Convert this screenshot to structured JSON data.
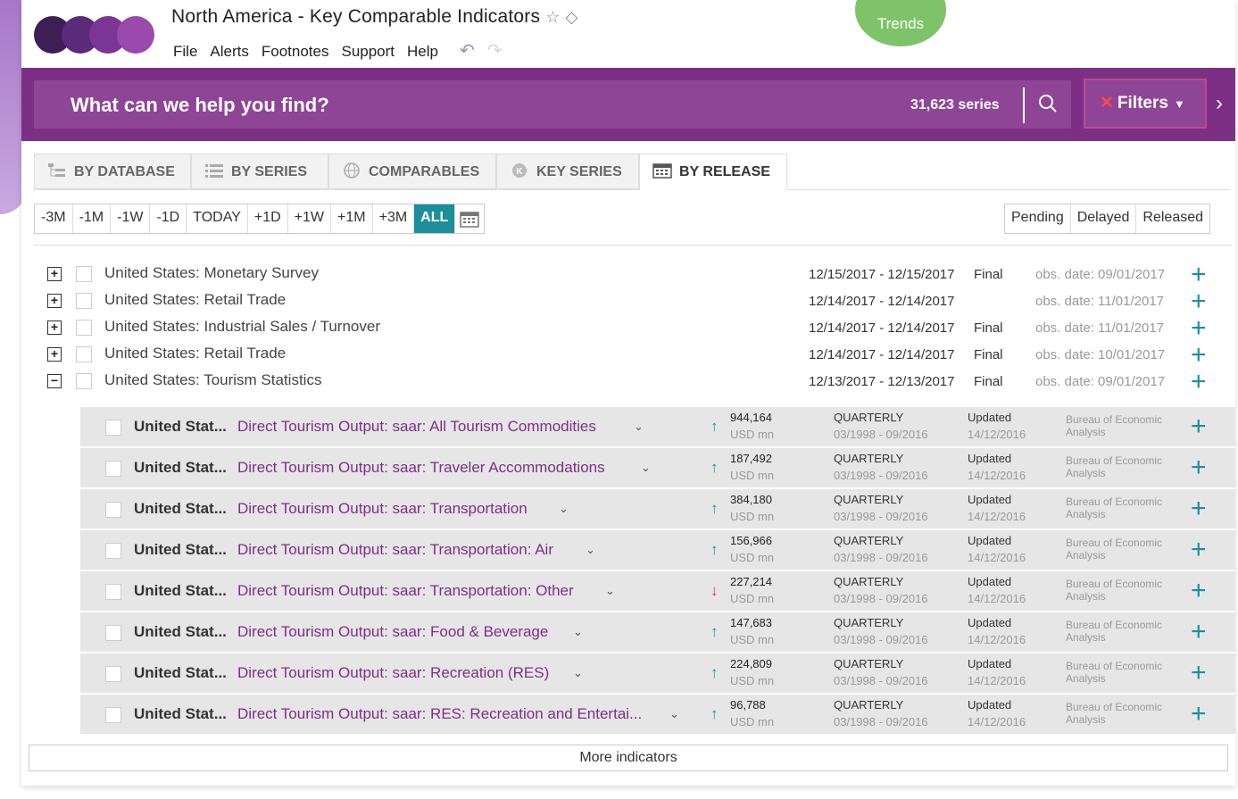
{
  "app": {
    "title": "North America - Key Comparable Indicators",
    "menu": [
      "File",
      "Alerts",
      "Footnotes",
      "Support",
      "Help"
    ],
    "trends_label": "Trends",
    "brand_color": "#7d2f86",
    "accent_color": "#1d8f9a"
  },
  "search": {
    "placeholder": "What can we help you find?",
    "series_count": "31,623 series",
    "filters_label": "Filters"
  },
  "tabs": [
    {
      "label": "BY DATABASE",
      "icon": "database-tree-icon"
    },
    {
      "label": "BY SERIES",
      "icon": "list-icon"
    },
    {
      "label": "COMPARABLES",
      "icon": "globe-icon"
    },
    {
      "label": "KEY SERIES",
      "icon": "key-series-icon"
    },
    {
      "label": "BY RELEASE",
      "icon": "calendar-icon",
      "active": true
    }
  ],
  "date_ranges": [
    "-3M",
    "-1M",
    "-1W",
    "-1D",
    "TODAY",
    "+1D",
    "+1W",
    "+1M",
    "+3M",
    "ALL"
  ],
  "active_range": "ALL",
  "status_buttons": [
    "Pending",
    "Delayed",
    "Released"
  ],
  "releases": [
    {
      "name": "United States: Monetary Survey",
      "dates": "12/15/2017 - 12/15/2017",
      "status": "Final",
      "obs": "obs. date: 09/01/2017",
      "expanded": false
    },
    {
      "name": "United States: Retail Trade",
      "dates": "12/14/2017 - 12/14/2017",
      "status": "",
      "obs": "obs. date: 11/01/2017",
      "expanded": false
    },
    {
      "name": "United States: Industrial Sales / Turnover",
      "dates": "12/14/2017 - 12/14/2017",
      "status": "Final",
      "obs": "obs. date: 11/01/2017",
      "expanded": false
    },
    {
      "name": "United States: Retail Trade",
      "dates": "12/14/2017 - 12/14/2017",
      "status": "Final",
      "obs": "obs. date: 10/01/2017",
      "expanded": false
    },
    {
      "name": "United States: Tourism Statistics",
      "dates": "12/13/2017 - 12/13/2017",
      "status": "Final",
      "obs": "obs. date: 09/01/2017",
      "expanded": true
    }
  ],
  "series": [
    {
      "country": "United Stat...",
      "name": "Direct Tourism Output: saar: All Tourism Commodities",
      "trend": "up",
      "value": "944,164",
      "unit": "USD mn",
      "freq": "QUARTERLY",
      "range": "03/1998 - 09/2016",
      "updated": "Updated",
      "updated_date": "14/12/2016",
      "source": "Bureau of Economic Analysis"
    },
    {
      "country": "United Stat...",
      "name": "Direct Tourism Output: saar: Traveler Accommodations",
      "trend": "up",
      "value": "187,492",
      "unit": "USD mn",
      "freq": "QUARTERLY",
      "range": "03/1998 - 09/2016",
      "updated": "Updated",
      "updated_date": "14/12/2016",
      "source": "Bureau of Economic Analysis"
    },
    {
      "country": "United Stat...",
      "name": "Direct Tourism Output: saar: Transportation",
      "trend": "up",
      "value": "384,180",
      "unit": "USD mn",
      "freq": "QUARTERLY",
      "range": "03/1998 - 09/2016",
      "updated": "Updated",
      "updated_date": "14/12/2016",
      "source": "Bureau of Economic Analysis"
    },
    {
      "country": "United Stat...",
      "name": "Direct Tourism Output: saar: Transportation: Air",
      "trend": "up",
      "value": "156,966",
      "unit": "USD mn",
      "freq": "QUARTERLY",
      "range": "03/1998 - 09/2016",
      "updated": "Updated",
      "updated_date": "14/12/2016",
      "source": "Bureau of Economic Analysis"
    },
    {
      "country": "United Stat...",
      "name": "Direct Tourism Output: saar: Transportation: Other",
      "trend": "down",
      "value": "227,214",
      "unit": "USD mn",
      "freq": "QUARTERLY",
      "range": "03/1998 - 09/2016",
      "updated": "Updated",
      "updated_date": "14/12/2016",
      "source": "Bureau of Economic Analysis"
    },
    {
      "country": "United Stat...",
      "name": "Direct Tourism Output: saar: Food & Beverage",
      "trend": "up",
      "value": "147,683",
      "unit": "USD mn",
      "freq": "QUARTERLY",
      "range": "03/1998 - 09/2016",
      "updated": "Updated",
      "updated_date": "14/12/2016",
      "source": "Bureau of Economic Analysis"
    },
    {
      "country": "United Stat...",
      "name": "Direct Tourism Output: saar: Recreation (RES)",
      "trend": "up",
      "value": "224,809",
      "unit": "USD mn",
      "freq": "QUARTERLY",
      "range": "03/1998 - 09/2016",
      "updated": "Updated",
      "updated_date": "14/12/2016",
      "source": "Bureau of Economic Analysis"
    },
    {
      "country": "United Stat...",
      "name": "Direct Tourism Output: saar: RES: Recreation and Entertai...",
      "trend": "up",
      "value": "96,788",
      "unit": "USD mn",
      "freq": "QUARTERLY",
      "range": "03/1998 - 09/2016",
      "updated": "Updated",
      "updated_date": "14/12/2016",
      "source": "Bureau of Economic Analysis"
    }
  ],
  "more_label": "More indicators"
}
